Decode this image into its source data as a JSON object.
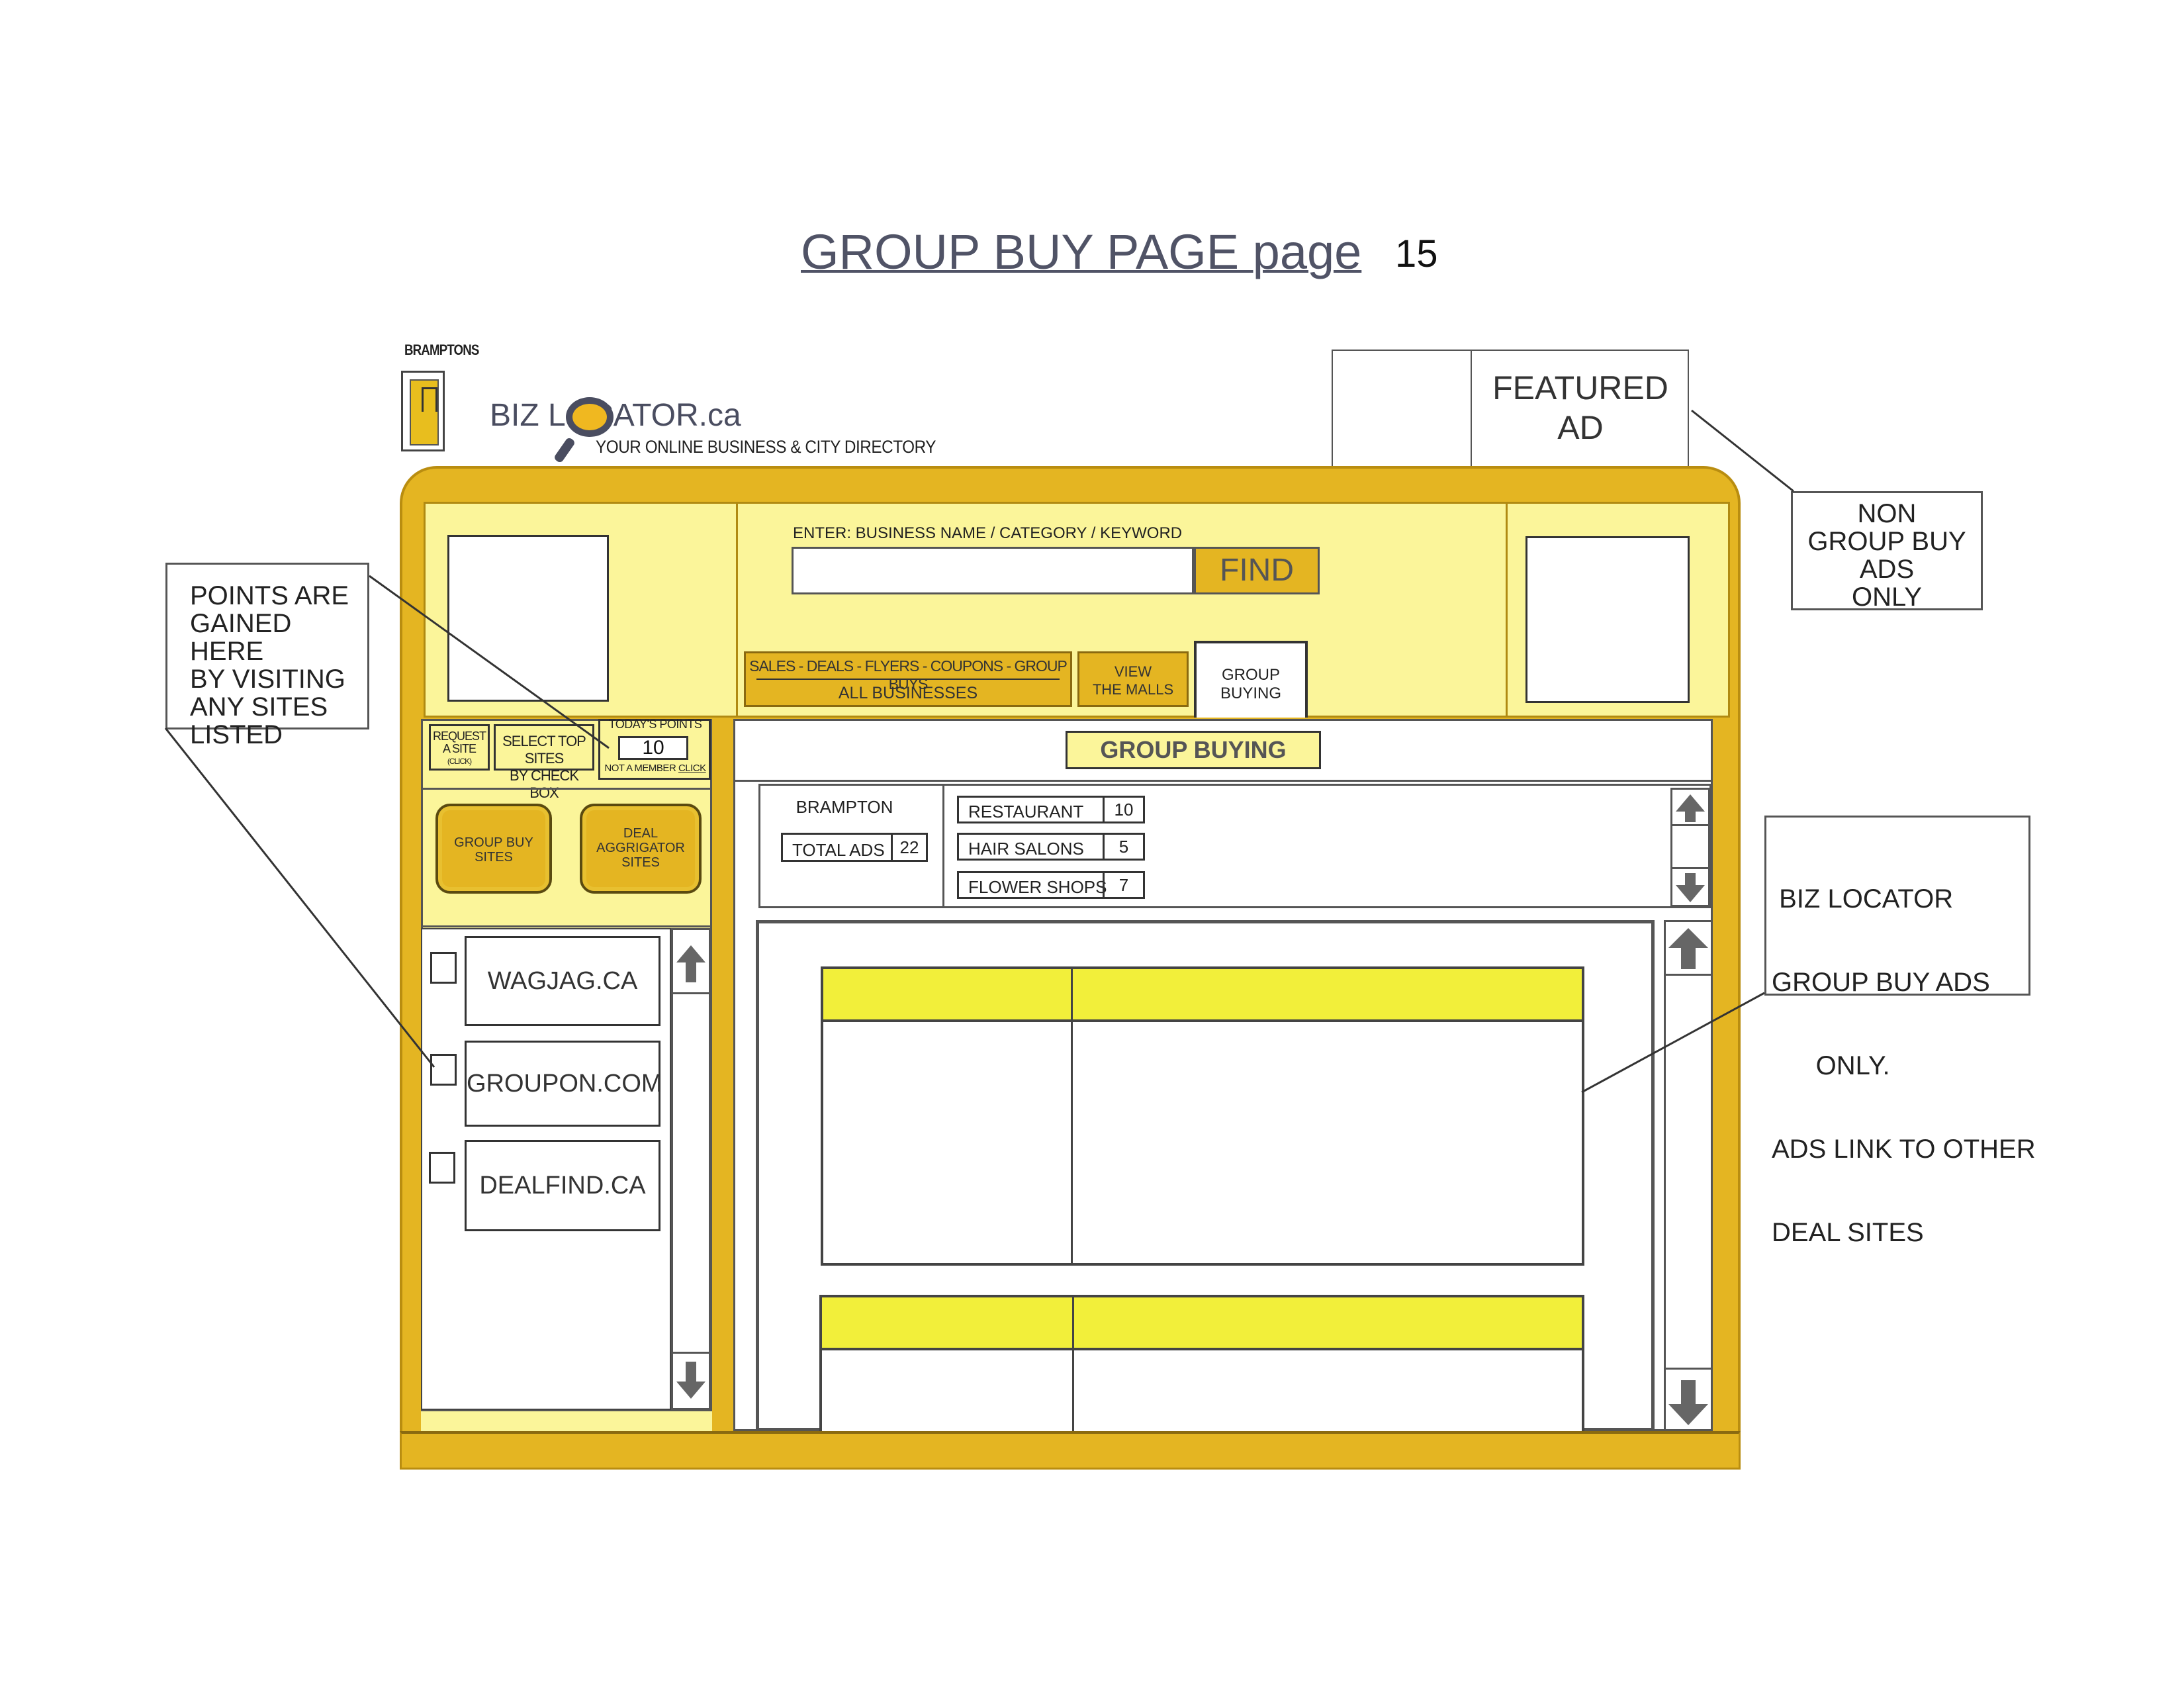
{
  "page": {
    "title": "GROUP BUY PAGE page",
    "page_number": "15"
  },
  "logo": {
    "city": "BRAMPTONS",
    "name": "BIZ LOCATOR.ca",
    "tagline": "YOUR ONLINE BUSINESS & CITY DIRECTORY"
  },
  "featured_ad": {
    "label_line1": "FEATURED",
    "label_line2": "AD"
  },
  "search": {
    "label": "ENTER: BUSINESS NAME / CATEGORY / KEYWORD",
    "value": "",
    "find_label": "FIND"
  },
  "tabs": {
    "sales_line1": "SALES - DEALS - FLYERS - COUPONS - GROUP BUYS",
    "sales_line2": "ALL BUSINESSES",
    "malls_line1": "VIEW",
    "malls_line2": "THE MALLS",
    "group_line1": "GROUP",
    "group_line2": "BUYING"
  },
  "left_panel": {
    "request_line1": "REQUEST",
    "request_line2": "A SITE",
    "request_line3": "(CLICK)",
    "select_line1": "SELECT TOP SITES",
    "select_line2": "BY CHECK BOX",
    "todays_points_label": "TODAY'S POINTS",
    "todays_points_value": "10",
    "not_member_text": "NOT A MEMBER",
    "not_member_link": "CLICK",
    "group_buy_line1": "GROUP BUY",
    "group_buy_line2": "SITES",
    "deal_agg_line1": "DEAL",
    "deal_agg_line2": "AGGRIGATOR",
    "deal_agg_line3": "SITES",
    "sites": [
      "WAGJAG.CA",
      "GROUPON.COM",
      "DEALFIND.CA"
    ]
  },
  "right_panel": {
    "header": "GROUP BUYING",
    "city": "BRAMPTON",
    "total_ads_label": "TOTAL  ADS",
    "total_ads_value": "22",
    "categories": [
      {
        "name": "RESTAURANT",
        "count": "10"
      },
      {
        "name": "HAIR SALONS",
        "count": "5"
      },
      {
        "name": "FLOWER SHOPS",
        "count": "7"
      }
    ]
  },
  "annotations": {
    "points": [
      "POINTS ARE",
      "GAINED HERE",
      "BY VISITING",
      "ANY SITES",
      "LISTED"
    ],
    "non_group": [
      "NON",
      "GROUP BUY",
      "ADS",
      "ONLY"
    ],
    "biz_group": [
      " BIZ LOCATOR",
      "GROUP BUY ADS",
      "      ONLY.",
      "ADS LINK TO OTHER",
      "DEAL SITES"
    ]
  },
  "colors": {
    "frame_gold": "#e4b522",
    "panel_pale_yellow": "#fbf59a",
    "card_header_yellow": "#f2ef3a",
    "title_slate": "#505366"
  },
  "icons": [
    "logo-icon",
    "magnifier-icon",
    "scroll-up-arrow-icon",
    "scroll-down-arrow-icon"
  ]
}
